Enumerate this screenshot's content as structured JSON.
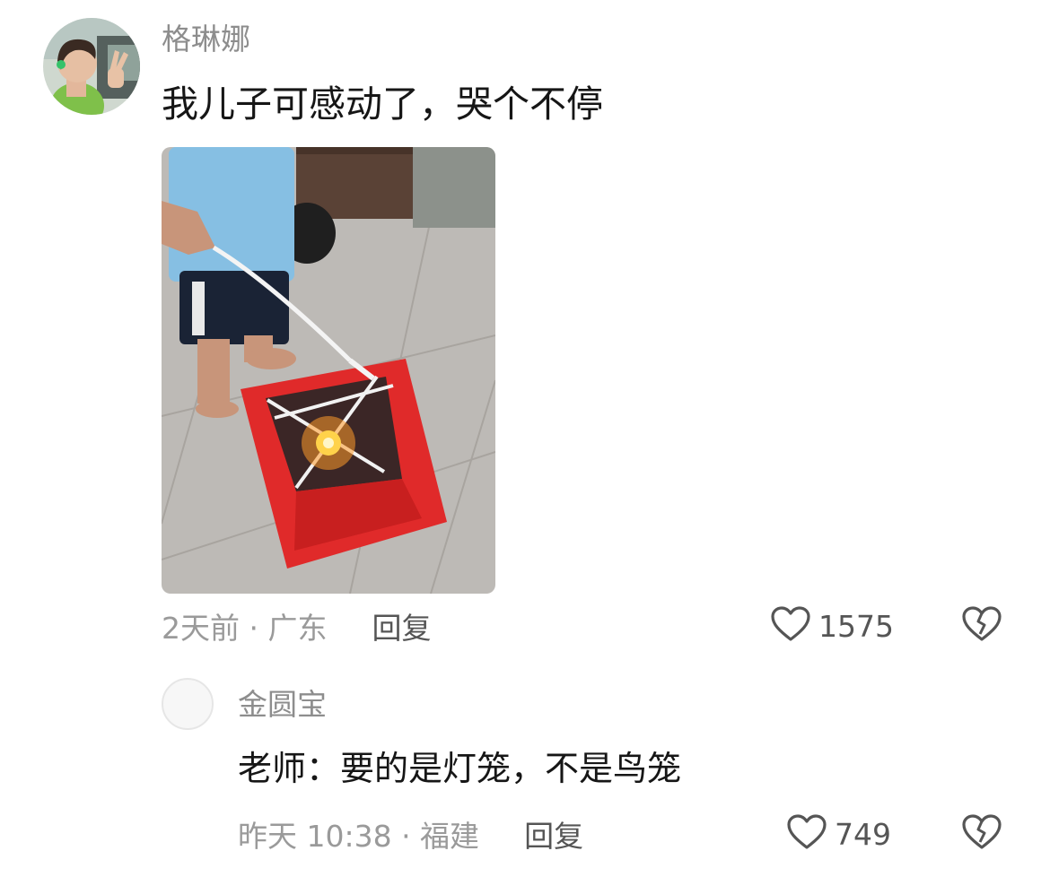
{
  "comment": {
    "username": "格琳娜",
    "text": "我儿子可感动了，哭个不停",
    "meta": "2天前 · 广东",
    "reply_label": "回复",
    "like_count": "1575",
    "avatar_icon": "child-photo-avatar",
    "image_icon": "red-lantern-photo"
  },
  "reply": {
    "username": "金圆宝",
    "text": "老师：要的是灯笼，不是鸟笼",
    "meta": "昨天 10:38 · 福建",
    "reply_label": "回复",
    "like_count": "749"
  },
  "icons": {
    "like": "heart-outline-icon",
    "dislike": "broken-heart-icon"
  },
  "colors": {
    "text": "#161616",
    "secondary": "#8d8d8d",
    "action": "#555555",
    "lantern_red": "#e02a2a"
  }
}
